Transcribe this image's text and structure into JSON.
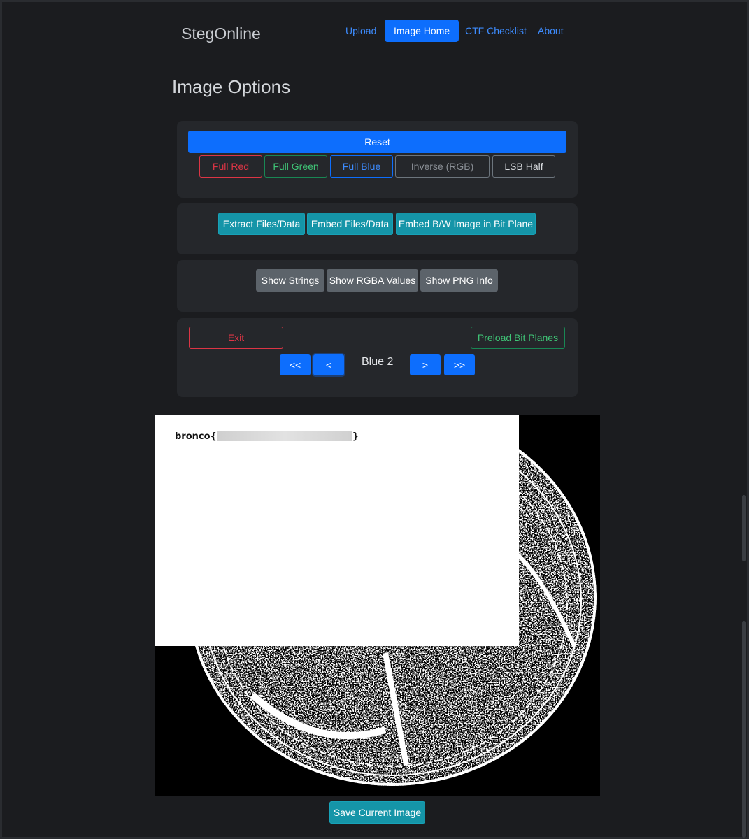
{
  "navbar": {
    "brand": "StegOnline",
    "links": [
      {
        "label": "Upload",
        "active": false
      },
      {
        "label": "Image Home",
        "active": true
      },
      {
        "label": "CTF Checklist",
        "active": false
      },
      {
        "label": "About",
        "active": false
      }
    ]
  },
  "page": {
    "title": "Image Options"
  },
  "color_panel": {
    "reset": "Reset",
    "full_red": "Full Red",
    "full_green": "Full Green",
    "full_blue": "Full Blue",
    "inverse": "Inverse (RGB)",
    "lsb_half": "LSB Half"
  },
  "data_panel": {
    "extract": "Extract Files/Data",
    "embed": "Embed Files/Data",
    "embed_bw": "Embed B/W Image in Bit Plane"
  },
  "info_panel": {
    "strings": "Show Strings",
    "rgba": "Show RGBA Values",
    "png_info": "Show PNG Info"
  },
  "bitplane_panel": {
    "exit": "Exit",
    "preload": "Preload Bit Planes",
    "first": "<<",
    "prev": "<",
    "current_plane": "Blue 2",
    "next": ">",
    "last": ">>"
  },
  "image": {
    "flag_prefix": "bronco{",
    "flag_suffix": "}"
  },
  "save_button": "Save Current Image",
  "colors": {
    "primary": "#0d6efd",
    "teal": "#1595a8",
    "grey": "#5c636a",
    "danger": "#dc3545",
    "success": "#198754"
  }
}
